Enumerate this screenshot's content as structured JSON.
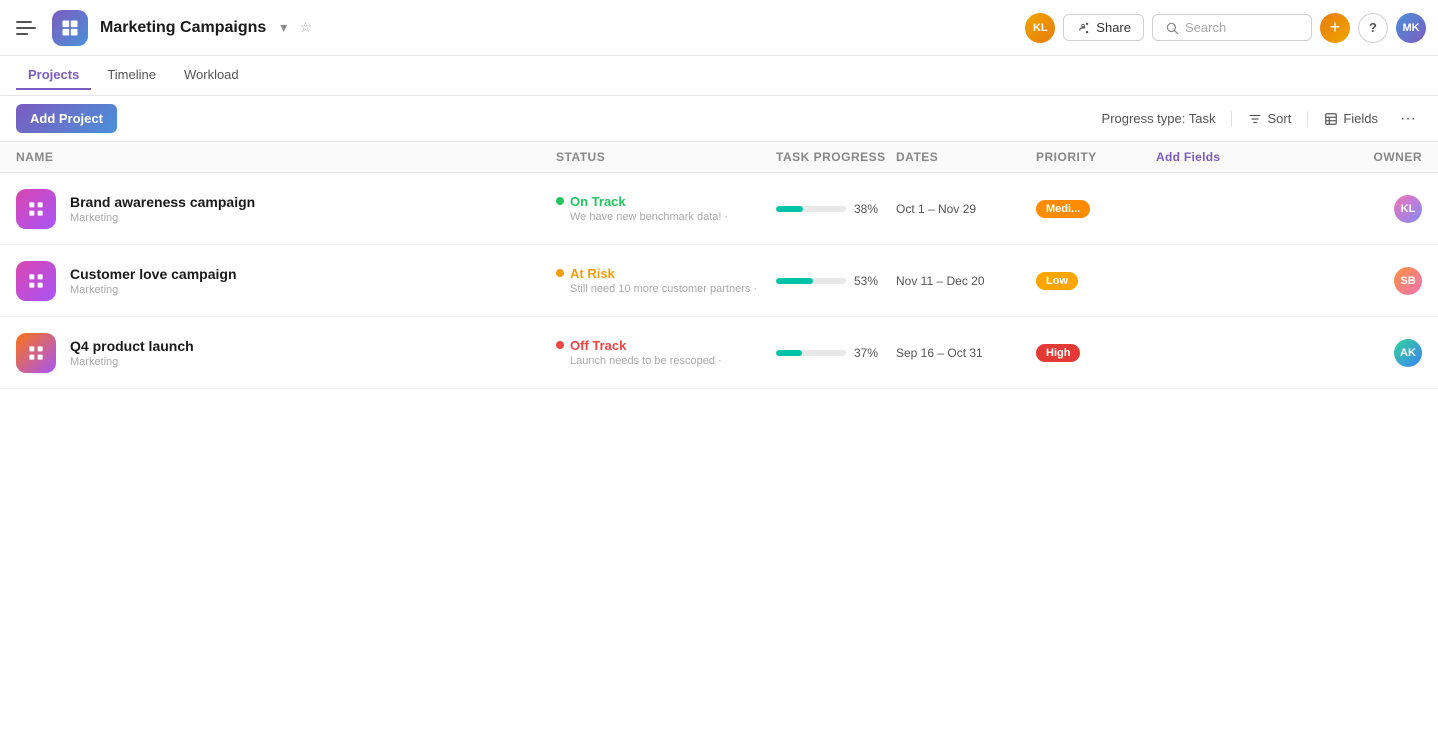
{
  "app": {
    "title": "Marketing Campaigns",
    "logo_alt": "Harvest logo"
  },
  "topbar": {
    "share_label": "Share",
    "search_placeholder": "Search",
    "help_label": "?",
    "plus_label": "+"
  },
  "subnav": {
    "items": [
      {
        "label": "Projects",
        "active": true
      },
      {
        "label": "Timeline",
        "active": false
      },
      {
        "label": "Workload",
        "active": false
      }
    ]
  },
  "toolbar": {
    "add_project_label": "Add Project",
    "progress_type_label": "Progress type: Task",
    "sort_label": "Sort",
    "fields_label": "Fields",
    "more_label": "···"
  },
  "table": {
    "columns": {
      "name": "Name",
      "status": "Status",
      "task_progress": "Task Progress",
      "dates": "Dates",
      "priority": "Priority",
      "add_fields": "Add Fields",
      "owner": "Owner"
    },
    "rows": [
      {
        "id": 1,
        "name": "Brand awareness campaign",
        "category": "Marketing",
        "icon_color": "icon-pink",
        "status_label": "On Track",
        "status_color": "#22c55e",
        "status_dot": "green",
        "status_note": "We have new benchmark data! ·",
        "progress": 38,
        "dates": "Oct 1 – Nov 29",
        "priority": "Medi...",
        "priority_class": "priority-medium",
        "owner_initials": "KL",
        "owner_class": "avatar-1"
      },
      {
        "id": 2,
        "name": "Customer love campaign",
        "category": "Marketing",
        "icon_color": "icon-pink",
        "status_label": "At Risk",
        "status_color": "#f59e0b",
        "status_dot": "orange",
        "status_note": "Still need 10 more customer partners ·",
        "progress": 53,
        "dates": "Nov 11 – Dec 20",
        "priority": "Low",
        "priority_class": "priority-low",
        "owner_initials": "SB",
        "owner_class": "avatar-2"
      },
      {
        "id": 3,
        "name": "Q4 product launch",
        "category": "Marketing",
        "icon_color": "icon-orange",
        "status_label": "Off Track",
        "status_color": "#ef4444",
        "status_dot": "red",
        "status_note": "Launch needs to be rescoped ·",
        "progress": 37,
        "dates": "Sep 16 – Oct 31",
        "priority": "High",
        "priority_class": "priority-high",
        "owner_initials": "AK",
        "owner_class": "avatar-3"
      }
    ]
  }
}
